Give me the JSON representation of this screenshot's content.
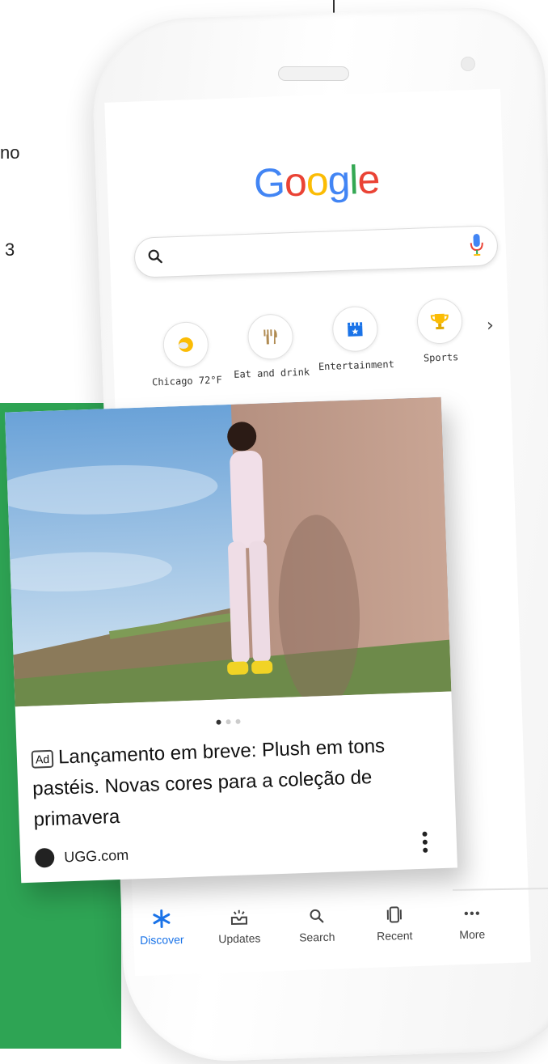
{
  "background": {
    "clipped_texts": [
      "no",
      "3"
    ]
  },
  "search": {
    "logo": [
      "G",
      "o",
      "o",
      "g",
      "l",
      "e"
    ],
    "logo_colors": [
      "#4285F4",
      "#EA4335",
      "#FBBC05",
      "#4285F4",
      "#34A853",
      "#EA4335"
    ],
    "placeholder": ""
  },
  "tiles": [
    {
      "label": "Chicago 72°F",
      "icon": "weather-icon"
    },
    {
      "label": "Eat and drink",
      "icon": "fork-knife-icon"
    },
    {
      "label": "Entertainment",
      "icon": "clapperboard-icon"
    },
    {
      "label": "Sports",
      "icon": "trophy-icon"
    }
  ],
  "card": {
    "ad_label": "Ad",
    "title": "Lançamento em breve: Plush em tons pastéis. Novas cores para a coleção de primavera",
    "source": "UGG.com",
    "pager": {
      "count": 3,
      "active": 0
    }
  },
  "nav": [
    {
      "label": "Discover",
      "icon": "asterisk-icon",
      "active": true
    },
    {
      "label": "Updates",
      "icon": "updates-icon",
      "active": false
    },
    {
      "label": "Search",
      "icon": "search-icon",
      "active": false
    },
    {
      "label": "Recent",
      "icon": "recent-icon",
      "active": false
    },
    {
      "label": "More",
      "icon": "more-horiz-icon",
      "active": false
    }
  ],
  "colors": {
    "accent": "#1a73e8",
    "green": "#2ea454"
  }
}
